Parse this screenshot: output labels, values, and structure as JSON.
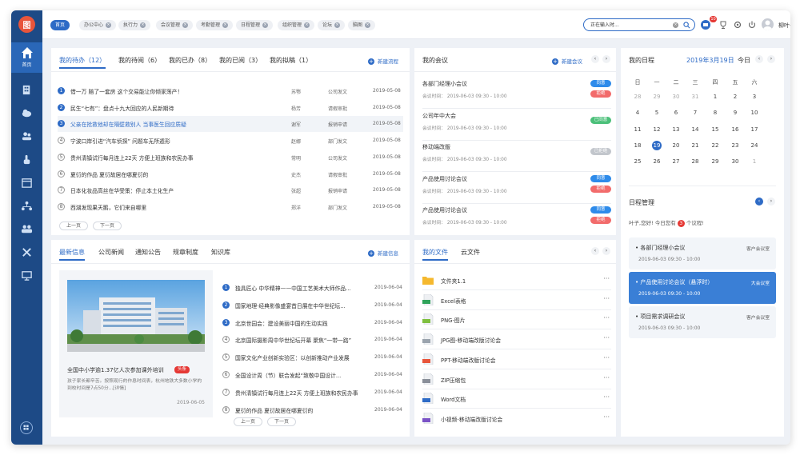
{
  "app": {
    "logo_text": "图"
  },
  "sidebar": {
    "home_label": "首页",
    "items": [
      "building-icon",
      "cloud-icon",
      "users-icon",
      "touch-icon",
      "calendar-icon",
      "org-icon",
      "team-icon",
      "tools-icon",
      "monitor-icon"
    ]
  },
  "topbar": {
    "tabs": [
      {
        "label": "首页",
        "active": true
      },
      {
        "label": "办公中心"
      },
      {
        "label": "执行力"
      },
      {
        "label": "会议管理"
      },
      {
        "label": "考勤管理"
      },
      {
        "label": "日程管理"
      },
      {
        "label": "组织管理"
      },
      {
        "label": "论坛"
      },
      {
        "label": "脑图"
      }
    ],
    "search_value": "正在输入时...",
    "notification_count": "10",
    "username": "柳叶子"
  },
  "todo": {
    "tabs": [
      "我的待办（12）",
      "我的待阅（6）",
      "我的已办（8）",
      "我的已阅（3）",
      "我的拟稿（1）"
    ],
    "new_label": "新建流程",
    "rows": [
      {
        "n": "1",
        "title": "借一万 赔了一套房 这个交易能让你倾家荡产！",
        "person": "苏鄂",
        "type": "公司发文",
        "date": "2019-05-08",
        "style": "blue"
      },
      {
        "n": "2",
        "title": "民生“七有”：盘点十九大回应的人民新期待",
        "person": "杨芳",
        "type": "请假审批",
        "date": "2019-05-08",
        "style": "blue"
      },
      {
        "n": "3",
        "title": "父亲在抢救他却在隔壁救别人 当事医生回应质疑",
        "person": "谢军",
        "type": "报销申请",
        "date": "2019-05-08",
        "style": "blue",
        "highlight": true
      },
      {
        "n": "4",
        "title": "宁波口岸引进“汽车侦探” 问题车无所遁形",
        "person": "赵娜",
        "type": "部门发文",
        "date": "2019-05-08",
        "style": "gray"
      },
      {
        "n": "5",
        "title": "贵州清镇试行每月连上22天 方便上班族和农民办事",
        "person": "常明",
        "type": "公司发文",
        "date": "2019-05-08",
        "style": "gray"
      },
      {
        "n": "6",
        "title": "夏衍的作品 夏衍故居在哪夏衍的",
        "person": "史杰",
        "type": "请假审批",
        "date": "2019-05-08",
        "style": "gray"
      },
      {
        "n": "7",
        "title": "日本化妆品高丝在华受策：停止本土化生产",
        "person": "张超",
        "type": "报销申请",
        "date": "2019-05-08",
        "style": "gray"
      },
      {
        "n": "8",
        "title": "西湖发现果天鹅，它们来自哪里",
        "person": "郑洋",
        "type": "部门发文",
        "date": "2019-05-08",
        "style": "gray"
      }
    ],
    "prev": "上一页",
    "next": "下一页"
  },
  "meetings": {
    "title": "我的会议",
    "new_label": "新建会议",
    "items": [
      {
        "title": "各部门经理小会议",
        "info": "会议时间： 2019-06-03 09:30 - 10:00",
        "pills": [
          {
            "label": "同意",
            "color": "#2e8bea"
          },
          {
            "label": "拒绝",
            "color": "#f26b6b"
          }
        ]
      },
      {
        "title": "公司年中大会",
        "info": "会议时间： 2019-06-03 09:30 - 10:00",
        "pills": [
          {
            "label": "已同意",
            "color": "#4cc07a"
          }
        ]
      },
      {
        "title": "移动端改版",
        "info": "会议时间： 2019-06-03 09:30 - 10:00",
        "pills": [
          {
            "label": "已拒绝",
            "color": "#c2c6cc"
          }
        ]
      },
      {
        "title": "产品使用讨论会议",
        "info": "会议时间： 2019-06-03 09:30 - 10:00",
        "pills": [
          {
            "label": "同意",
            "color": "#2e8bea"
          },
          {
            "label": "拒绝",
            "color": "#f26b6b"
          }
        ]
      },
      {
        "title": "产品使用讨论会议",
        "info": "会议时间： 2019-06-03 09:30 - 10:00",
        "pills": [
          {
            "label": "同意",
            "color": "#2e8bea"
          },
          {
            "label": "拒绝",
            "color": "#f26b6b"
          }
        ]
      }
    ]
  },
  "calendar": {
    "title": "我的日程",
    "date_label": "2019年3月19日",
    "today_label": "今日",
    "weekdays": [
      "日",
      "一",
      "二",
      "三",
      "四",
      "五",
      "六"
    ],
    "weeks": [
      [
        {
          "d": "28",
          "m": 1
        },
        {
          "d": "29",
          "m": 1
        },
        {
          "d": "30",
          "m": 1
        },
        {
          "d": "31",
          "m": 1
        },
        {
          "d": "1"
        },
        {
          "d": "2"
        },
        {
          "d": "3"
        }
      ],
      [
        {
          "d": "4"
        },
        {
          "d": "5"
        },
        {
          "d": "6"
        },
        {
          "d": "7"
        },
        {
          "d": "8"
        },
        {
          "d": "9"
        },
        {
          "d": "10"
        }
      ],
      [
        {
          "d": "11"
        },
        {
          "d": "12"
        },
        {
          "d": "13"
        },
        {
          "d": "14"
        },
        {
          "d": "15"
        },
        {
          "d": "16"
        },
        {
          "d": "17"
        }
      ],
      [
        {
          "d": "18"
        },
        {
          "d": "19",
          "t": 1
        },
        {
          "d": "20"
        },
        {
          "d": "21"
        },
        {
          "d": "22"
        },
        {
          "d": "23"
        },
        {
          "d": "24"
        }
      ],
      [
        {
          "d": "25"
        },
        {
          "d": "26"
        },
        {
          "d": "27"
        },
        {
          "d": "28"
        },
        {
          "d": "29"
        },
        {
          "d": "30"
        },
        {
          "d": "1",
          "m": 1
        }
      ]
    ]
  },
  "schedule": {
    "title": "日程管理",
    "greeting_pre": "叶子,您好! 今日您有",
    "count": "3",
    "greeting_post": "个议程!",
    "items": [
      {
        "title": "• 各部门经理小会议",
        "loc": "客户会议室",
        "date": "2019-06-03 09:30 - 10:00"
      },
      {
        "title": "• 产品使用讨论会议（悬浮时）",
        "loc": "大会议室",
        "date": "2019-06-03 09:30 - 10:00",
        "active": true
      },
      {
        "title": "• 项目需求调研会议",
        "loc": "客户会议室",
        "date": "2019-06-03 09:30 - 10:00"
      }
    ]
  },
  "news": {
    "tabs": [
      "最新信息",
      "公司新闻",
      "通知公告",
      "规章制度",
      "知识库"
    ],
    "new_label": "新建信息",
    "feature_title": "全国中小学逾1.37亿人次参加课外培训",
    "feature_tag": "头条",
    "feature_desc": "孩子家长都辛苦。按照现行的作息时间表，杭州地铁大多数小学的到校时间是7点50分...[详情]",
    "feature_date": "2019-06-05",
    "items": [
      {
        "n": "1",
        "title": "独具匠心 中华精神——中国工艺美术大师作品...",
        "date": "2019-06-04",
        "style": "blue"
      },
      {
        "n": "2",
        "title": "国家地理·经典影像盛宴首日展在中华世纪坛...",
        "date": "2019-06-04",
        "style": "blue"
      },
      {
        "n": "3",
        "title": "北京世园会：建设美丽中国的生动实践",
        "date": "2019-06-04",
        "style": "blue"
      },
      {
        "n": "4",
        "title": "北京国际摄影周中华世纪坛开幕 聚焦“一带一路”",
        "date": "2019-06-04",
        "style": "gray"
      },
      {
        "n": "5",
        "title": "国家文化产业创新实验区：以创新推动产业发展",
        "date": "2019-06-04",
        "style": "gray"
      },
      {
        "n": "6",
        "title": "全国设计周（节）联合发起“致敬中国设计...",
        "date": "2019-06-04",
        "style": "gray"
      },
      {
        "n": "7",
        "title": "贵州清镇试行每月连上22天 方便上班族和农民办事",
        "date": "2019-06-04",
        "style": "gray"
      },
      {
        "n": "8",
        "title": "夏衍的作品 夏衍故居在哪夏衍的",
        "date": "2019-06-04",
        "style": "gray"
      }
    ],
    "prev": "上一页",
    "next": "下一页"
  },
  "files": {
    "tabs": [
      "我的文件",
      "云文件"
    ],
    "items": [
      {
        "name": "文件夹1.1",
        "icon": "folder-icon",
        "color": "#f5b82e"
      },
      {
        "name": "Excel表格",
        "icon": "excel-icon",
        "color": "#2fa35a"
      },
      {
        "name": "PNG-图片",
        "icon": "png-icon",
        "color": "#7fbf3f"
      },
      {
        "name": "JPG图-移动端改版讨论会",
        "icon": "jpg-icon",
        "color": "#9aa3ad"
      },
      {
        "name": "PPT-移动端改版讨论会",
        "icon": "ppt-icon",
        "color": "#e8553b"
      },
      {
        "name": "ZIP压缩包",
        "icon": "zip-icon",
        "color": "#8a8f99"
      },
      {
        "name": "Word文档",
        "icon": "word-icon",
        "color": "#2e6bc6"
      },
      {
        "name": "小视频-移动端改版讨论会",
        "icon": "video-icon",
        "color": "#7a53c6"
      }
    ],
    "more": "···"
  }
}
